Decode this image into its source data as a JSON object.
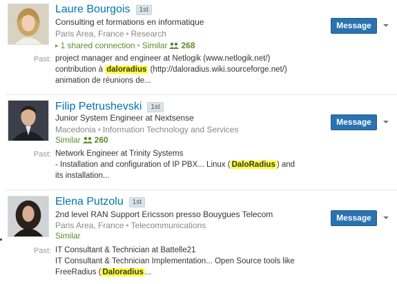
{
  "results": [
    {
      "name": "Laure Bourgois",
      "degree": "1st",
      "headline": "Consulting et formations en informatique",
      "location": "Paris Area, France",
      "industry": "Research",
      "shared": "1 shared connection",
      "similar": "Similar",
      "connections": "268",
      "past_label": "Past:",
      "past_line1": "project manager and engineer at Netlogik (www.netlogik.net/)",
      "past_line2_pre": "contribution à ",
      "past_line2_hl": "daloradius",
      "past_line2_post": " (http://daloradius.wiki.sourceforge.net/)",
      "past_line3": "animation de réunions de...",
      "message_label": "Message"
    },
    {
      "name": "Filip Petrushevski",
      "degree": "1st",
      "headline": "Junior System Engineer at Nextsense",
      "location": "Macedonia",
      "industry": "Information Technology and Services",
      "similar": "Similar",
      "connections": "260",
      "past_label": "Past:",
      "past_line1": "Network Engineer at Trinity Systems",
      "past_line2_pre": "- Installation and configuration of IP PBX... Linux (",
      "past_line2_hl": "DaloRadius",
      "past_line2_post": ") and",
      "past_line3": "its installation...",
      "message_label": "Message"
    },
    {
      "name": "Elena Putzolu",
      "degree": "1st",
      "headline": "2nd level RAN Support Ericsson presso Bouygues Telecom",
      "location": "Paris Area, France",
      "industry": "Telecommunications",
      "similar": "Similar",
      "past_label": "Past:",
      "past_line1": "IT Consultant & Technician at Battelle21",
      "past_line2": "IT Consultant & Technician Implementation... Open Source tools like",
      "past_line3_pre": "FreeRadius (",
      "past_line3_hl": "Daloradius",
      "past_line3_post": "...",
      "message_label": "Message"
    }
  ],
  "icons": {
    "people": "people-icon",
    "dropdown": "chevron-down-icon",
    "arrow": "triangle-right-icon"
  },
  "colors": {
    "link": "#0073b1",
    "button": "#2a72b0",
    "social": "#5a8a2b",
    "highlight": "#ffff3a"
  }
}
